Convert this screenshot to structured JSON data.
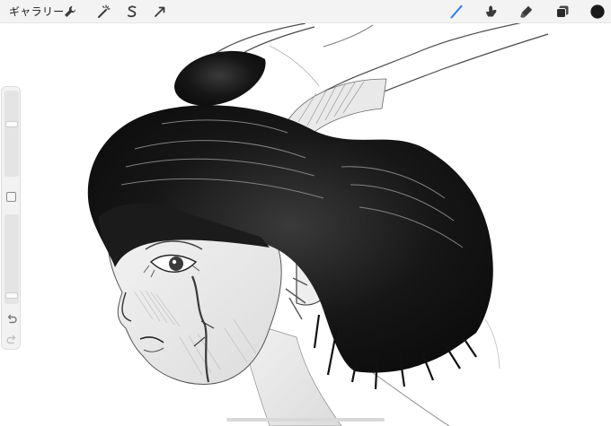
{
  "app": {
    "gallery_label": "ギャラリー"
  },
  "toolbar": {
    "left_tools": [
      "wrench-icon",
      "magic-wand-icon",
      "selection-icon",
      "transform-arrow-icon"
    ],
    "right_tools": [
      "brush-icon",
      "smudge-icon",
      "eraser-icon",
      "layers-icon",
      "color-swatch"
    ],
    "active_tool": "brush-icon",
    "active_tool_color": "#2f7cf6",
    "current_color": "#1a1a1a"
  },
  "sidebar": {
    "brush_size_level": 0.62,
    "brush_opacity_level": 0.05,
    "icons": [
      "modify-button-icon",
      "undo-icon",
      "redo-icon"
    ]
  }
}
